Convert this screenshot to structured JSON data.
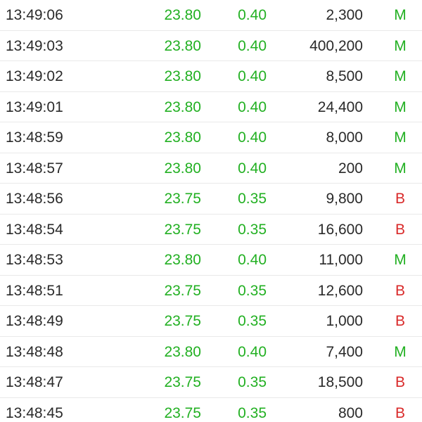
{
  "colors": {
    "up": "#22b022",
    "buy_side": "#22b022",
    "sell_side": "#d92a2a",
    "text": "#2a2a2a",
    "divider": "#e9e9e9"
  },
  "trades": [
    {
      "time": "13:49:06",
      "price": "23.80",
      "change": "0.40",
      "volume": "2,300",
      "side": "M"
    },
    {
      "time": "13:49:03",
      "price": "23.80",
      "change": "0.40",
      "volume": "400,200",
      "side": "M"
    },
    {
      "time": "13:49:02",
      "price": "23.80",
      "change": "0.40",
      "volume": "8,500",
      "side": "M"
    },
    {
      "time": "13:49:01",
      "price": "23.80",
      "change": "0.40",
      "volume": "24,400",
      "side": "M"
    },
    {
      "time": "13:48:59",
      "price": "23.80",
      "change": "0.40",
      "volume": "8,000",
      "side": "M"
    },
    {
      "time": "13:48:57",
      "price": "23.80",
      "change": "0.40",
      "volume": "200",
      "side": "M"
    },
    {
      "time": "13:48:56",
      "price": "23.75",
      "change": "0.35",
      "volume": "9,800",
      "side": "B"
    },
    {
      "time": "13:48:54",
      "price": "23.75",
      "change": "0.35",
      "volume": "16,600",
      "side": "B"
    },
    {
      "time": "13:48:53",
      "price": "23.80",
      "change": "0.40",
      "volume": "11,000",
      "side": "M"
    },
    {
      "time": "13:48:51",
      "price": "23.75",
      "change": "0.35",
      "volume": "12,600",
      "side": "B"
    },
    {
      "time": "13:48:49",
      "price": "23.75",
      "change": "0.35",
      "volume": "1,000",
      "side": "B"
    },
    {
      "time": "13:48:48",
      "price": "23.80",
      "change": "0.40",
      "volume": "7,400",
      "side": "M"
    },
    {
      "time": "13:48:47",
      "price": "23.75",
      "change": "0.35",
      "volume": "18,500",
      "side": "B"
    },
    {
      "time": "13:48:45",
      "price": "23.75",
      "change": "0.35",
      "volume": "800",
      "side": "B"
    }
  ]
}
